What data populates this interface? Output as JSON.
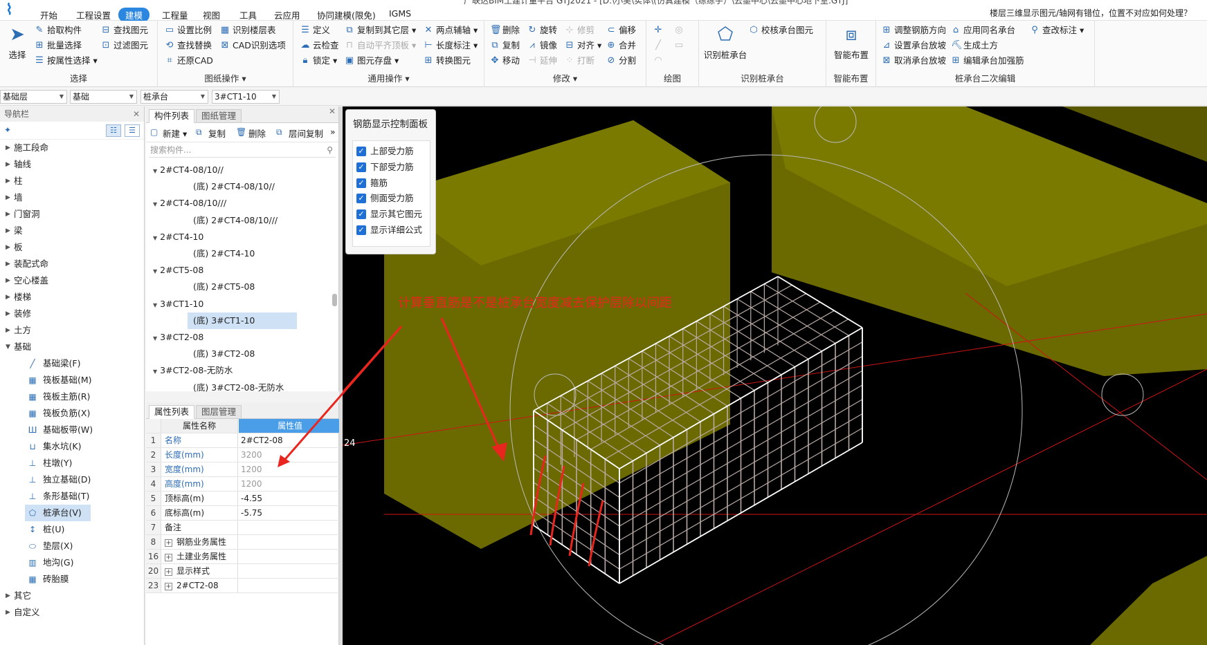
{
  "window": {
    "title": "广联达BIM土建计量平台 GTJ2021 - [D:\\小吴\\实体\\(仿真建模（练练手）\\云墨中心\\云墨中心地下室.GTJ]"
  },
  "menu": {
    "items": [
      "开始",
      "工程设置",
      "建模",
      "工程量",
      "视图",
      "工具",
      "云应用",
      "协同建模(限免)",
      "IGMS"
    ],
    "active_index": 2,
    "help": "楼层三维显示图元/轴网有错位，位置不对应如何处理？"
  },
  "ribbon": {
    "select": {
      "big": "选择",
      "items": [
        "拾取构件",
        "批量选择",
        "按属性选择",
        "查找图元",
        "过滤图元"
      ],
      "group": "选择"
    },
    "drawing": {
      "items": [
        "设置比例",
        "查找替换",
        "还原CAD",
        "识别楼层表",
        "CAD识别选项"
      ],
      "group": "图纸操作"
    },
    "common": {
      "items": [
        "定义",
        "云检查",
        "锁定",
        "复制到其它层",
        "自动平齐顶板",
        "图元存盘",
        "两点辅轴",
        "长度标注",
        "转换图元"
      ],
      "group": "通用操作"
    },
    "modify": {
      "items": [
        "删除",
        "复制",
        "移动",
        "旋转",
        "镜像",
        "延伸",
        "修剪",
        "对齐",
        "打断",
        "偏移",
        "合并",
        "分割"
      ],
      "group": "修改"
    },
    "draw": {
      "group": "绘图"
    },
    "identify": {
      "big": "识别桩承台",
      "item": "校核承台图元",
      "group": "识别桩承台"
    },
    "smart": {
      "big": "智能布置",
      "group": "智能布置"
    },
    "second": {
      "items": [
        "调整钢筋方向",
        "设置承台放坡",
        "取消承台放坡",
        "应用同名承台",
        "生成土方",
        "编辑承台加强筋",
        "查改标注"
      ],
      "group": "桩承台二次编辑"
    }
  },
  "selectors": [
    "基础层",
    "基础",
    "桩承台",
    "3#CT1-10"
  ],
  "nav": {
    "title": "导航栏",
    "top": [
      "施工段命",
      "轴线",
      "柱",
      "墙",
      "门窗洞",
      "梁",
      "板",
      "装配式命",
      "空心楼盖",
      "楼梯",
      "装修",
      "土方",
      "基础"
    ],
    "sub": [
      "基础梁(F)",
      "筏板基础(M)",
      "筏板主筋(R)",
      "筏板负筋(X)",
      "基础板带(W)",
      "集水坑(K)",
      "柱墩(Y)",
      "独立基础(D)",
      "条形基础(T)",
      "桩承台(V)",
      "桩(U)",
      "垫层(X)",
      "地沟(G)",
      "砖胎膜"
    ],
    "bottom": [
      "其它",
      "自定义"
    ],
    "active_sub": 9
  },
  "components": {
    "tabs": [
      "构件列表",
      "图纸管理"
    ],
    "tools": [
      "新建",
      "复制",
      "删除",
      "层间复制"
    ],
    "search_placeholder": "搜索构件...",
    "tree": [
      {
        "label": "2#CT4-08/10//",
        "level": 0
      },
      {
        "label": "(底) 2#CT4-08/10//",
        "level": 1
      },
      {
        "label": "2#CT4-08/10///",
        "level": 0
      },
      {
        "label": "(底) 2#CT4-08/10///",
        "level": 1
      },
      {
        "label": "2#CT4-10",
        "level": 0
      },
      {
        "label": "(底) 2#CT4-10",
        "level": 1
      },
      {
        "label": "2#CT5-08",
        "level": 0
      },
      {
        "label": "(底) 2#CT5-08",
        "level": 1
      },
      {
        "label": "3#CT1-10",
        "level": 0
      },
      {
        "label": "(底) 3#CT1-10",
        "level": 1,
        "selected": true
      },
      {
        "label": "3#CT2-08",
        "level": 0
      },
      {
        "label": "(底) 3#CT2-08",
        "level": 1
      },
      {
        "label": "3#CT2-08-无防水",
        "level": 0
      },
      {
        "label": "(底) 3#CT2-08-无防水",
        "level": 1
      }
    ]
  },
  "properties": {
    "tabs": [
      "属性列表",
      "图层管理"
    ],
    "header": [
      "属性名称",
      "属性值"
    ],
    "rows": [
      {
        "n": "1",
        "k": "名称",
        "v": "2#CT2-08",
        "kblue": true,
        "vgray": false,
        "plus": false
      },
      {
        "n": "2",
        "k": "长度(mm)",
        "v": "3200",
        "kblue": true,
        "vgray": true,
        "plus": false
      },
      {
        "n": "3",
        "k": "宽度(mm)",
        "v": "1200",
        "kblue": true,
        "vgray": true,
        "plus": false
      },
      {
        "n": "4",
        "k": "高度(mm)",
        "v": "1200",
        "kblue": true,
        "vgray": true,
        "plus": false
      },
      {
        "n": "5",
        "k": "顶标高(m)",
        "v": "-4.55",
        "kblue": false,
        "vgray": false,
        "plus": false
      },
      {
        "n": "6",
        "k": "底标高(m)",
        "v": "-5.75",
        "kblue": false,
        "vgray": false,
        "plus": false
      },
      {
        "n": "7",
        "k": "备注",
        "v": "",
        "kblue": false,
        "vgray": false,
        "plus": false
      },
      {
        "n": "8",
        "k": "钢筋业务属性",
        "v": "",
        "kblue": false,
        "vgray": false,
        "plus": true
      },
      {
        "n": "16",
        "k": "土建业务属性",
        "v": "",
        "kblue": false,
        "vgray": false,
        "plus": true
      },
      {
        "n": "20",
        "k": "显示样式",
        "v": "",
        "kblue": false,
        "vgray": false,
        "plus": true
      },
      {
        "n": "23",
        "k": "2#CT2-08",
        "v": "",
        "kblue": false,
        "vgray": false,
        "plus": true
      }
    ]
  },
  "rebar_panel": {
    "title": "钢筋显示控制面板",
    "options": [
      "上部受力筋",
      "下部受力筋",
      "箍筋",
      "侧面受力筋",
      "显示其它图元",
      "显示详细公式"
    ]
  },
  "annotation": "计算垂直筋是不是桩承台宽度减去保护层除以间距",
  "viewport": {
    "coord_label": "24"
  },
  "colors": {
    "accent": "#2b86e0",
    "annotation": "#e8261f",
    "solid": "#6b6a00",
    "rebar": "#b9aaa5"
  }
}
